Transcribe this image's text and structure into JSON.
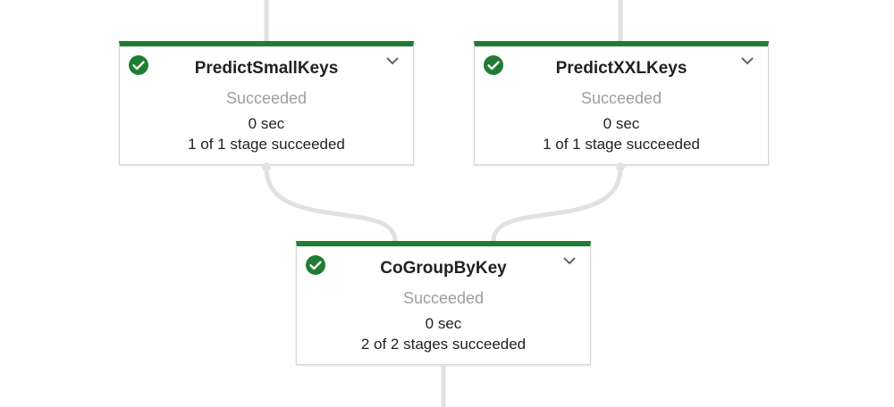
{
  "accent_color": "#1e7d32",
  "nodes": [
    {
      "id": "predict-small-keys",
      "title": "PredictSmallKeys",
      "status": "Succeeded",
      "duration": "0 sec",
      "stages": "1 of 1 stage succeeded",
      "status_icon": "check-circle-icon",
      "expand_icon": "chevron-down-icon"
    },
    {
      "id": "predict-xxl-keys",
      "title": "PredictXXLKeys",
      "status": "Succeeded",
      "duration": "0 sec",
      "stages": "1 of 1 stage succeeded",
      "status_icon": "check-circle-icon",
      "expand_icon": "chevron-down-icon"
    },
    {
      "id": "co-group-by-key",
      "title": "CoGroupByKey",
      "status": "Succeeded",
      "duration": "0 sec",
      "stages": "2 of 2 stages succeeded",
      "status_icon": "check-circle-icon",
      "expand_icon": "chevron-down-icon"
    }
  ]
}
